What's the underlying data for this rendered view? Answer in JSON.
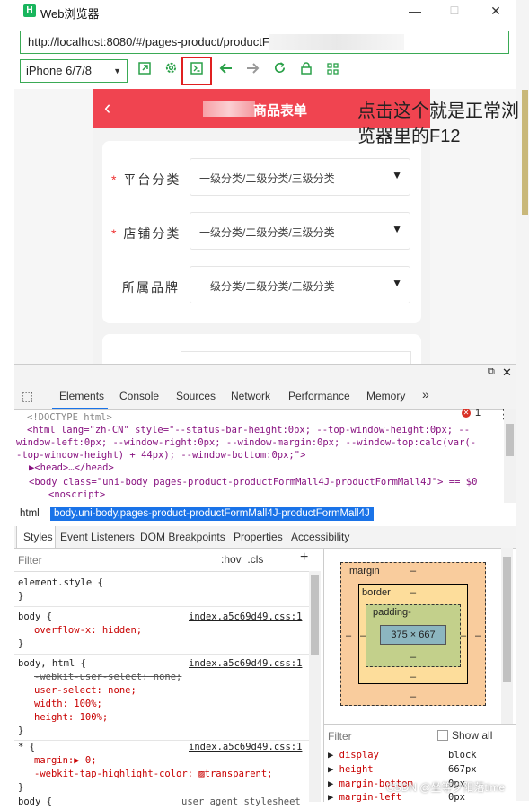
{
  "window": {
    "title": "Web浏览器",
    "logo_glyph": "H",
    "min_glyph": "—",
    "max_glyph": "☐",
    "close_glyph": "✕"
  },
  "toolbar": {
    "url": "http://localhost:8080/#/pages-product/productF",
    "device": "iPhone 6/7/8",
    "icons": [
      "open-external-icon",
      "settings-icon",
      "console-icon",
      "back-arrow-icon",
      "forward-arrow-icon",
      "refresh-icon",
      "lock-icon",
      "qrcode-icon"
    ]
  },
  "page": {
    "title": "商品表单",
    "back_glyph": "‹",
    "rows": [
      {
        "label": "平台分类",
        "required": true,
        "value": "一级分类/二级分类/三级分类"
      },
      {
        "label": "店铺分类",
        "required": true,
        "value": "一级分类/二级分类/三级分类"
      },
      {
        "label": "所属品牌",
        "required": false,
        "value": "一级分类/二级分类/三级分类"
      }
    ],
    "required_mark": "*",
    "caret": "▼"
  },
  "annotation": "点击这个就是正常浏览器里的F12",
  "devtools": {
    "tabs": [
      "Elements",
      "Console",
      "Sources",
      "Network",
      "Performance",
      "Memory",
      "»"
    ],
    "error_count": "1",
    "dom": {
      "doctype": "<!DOCTYPE html>",
      "html_open_1": "<html lang=\"zh-CN\" style=\"--status-bar-height:0px; --top-window-height:0px; --",
      "html_open_2": "window-left:0px; --window-right:0px; --window-margin:0px; --window-top:calc(var(-",
      "html_open_3": "-top-window-height) + 44px); --window-bottom:0px;\">",
      "head": "▶<head>…</head>",
      "body": "<body class=\"uni-body pages-product-productFormMall4J-productFormMall4J\"> == $0",
      "noscript": "<noscript>"
    },
    "breadcrumb": [
      "html",
      "body.uni-body.pages-product-productFormMall4J-productFormMall4J"
    ],
    "subtabs": [
      "Styles",
      "Event Listeners",
      "DOM Breakpoints",
      "Properties",
      "Accessibility"
    ],
    "styles": {
      "filter_placeholder": "Filter",
      "hov": ":hov",
      "cls": ".cls",
      "plus": "+",
      "rules": [
        {
          "selector": "element.style {",
          "source": "",
          "props": []
        },
        {
          "selector": "body {",
          "source": "index.a5c69d49.css:1",
          "props": [
            {
              "text": "overflow-x: hidden;",
              "strike": false
            }
          ]
        },
        {
          "selector": "body, html {",
          "source": "index.a5c69d49.css:1",
          "props": [
            {
              "text": "-webkit-user-select: none;",
              "strike": true
            },
            {
              "text": "user-select: none;",
              "strike": false
            },
            {
              "text": "width: 100%;",
              "strike": false
            },
            {
              "text": "height: 100%;",
              "strike": false
            }
          ]
        },
        {
          "selector": "* {",
          "source": "index.a5c69d49.css:1",
          "props": [
            {
              "text": "margin:▶ 0;",
              "strike": false
            },
            {
              "text": "-webkit-tap-highlight-color: ▨transparent;",
              "strike": false
            }
          ]
        },
        {
          "selector": "body {",
          "source": "user agent stylesheet",
          "props": []
        }
      ]
    },
    "boxmodel": {
      "margin_label": "margin",
      "border_label": "border",
      "padding_label": "padding-",
      "content": "375 × 667",
      "dash": "–"
    },
    "computed": {
      "filter_placeholder": "Filter",
      "show_all": "Show all",
      "props": [
        {
          "name": "display",
          "value": "block"
        },
        {
          "name": "height",
          "value": "667px"
        },
        {
          "name": "margin-bottom",
          "value": "0px"
        },
        {
          "name": "margin-left",
          "value": "0px"
        }
      ]
    }
  },
  "watermark": "CSDN @坐等夕阳落time",
  "colors": {
    "accent": "#3aaa55",
    "header": "#f04450",
    "highlight": "#e02020"
  }
}
